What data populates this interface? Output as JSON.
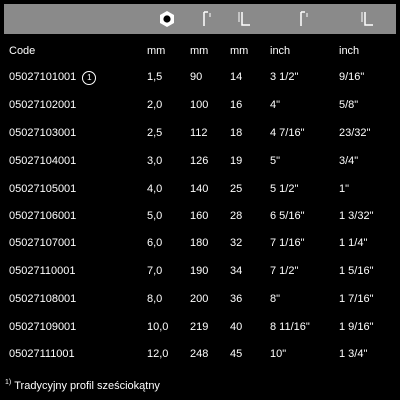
{
  "header_icons": [
    {
      "name": "hexagon-socket-icon"
    },
    {
      "name": "bracket-dimension-icon"
    },
    {
      "name": "l-dimension-icon"
    },
    {
      "name": "bracket-dimension-inch-icon"
    },
    {
      "name": "l-dimension-inch-icon"
    }
  ],
  "columns": [
    "Code",
    "mm",
    "mm",
    "mm",
    "inch",
    "inch"
  ],
  "rows": [
    {
      "code": "05027101001",
      "note": "1",
      "c1": "1,5",
      "c2": "90",
      "c3": "14",
      "c4": "3 1/2\"",
      "c5": "9/16\""
    },
    {
      "code": "05027102001",
      "c1": "2,0",
      "c2": "100",
      "c3": "16",
      "c4": "4\"",
      "c5": "5/8\""
    },
    {
      "code": "05027103001",
      "c1": "2,5",
      "c2": "112",
      "c3": "18",
      "c4": "4 7/16\"",
      "c5": "23/32\""
    },
    {
      "code": "05027104001",
      "c1": "3,0",
      "c2": "126",
      "c3": "19",
      "c4": "5\"",
      "c5": "3/4\""
    },
    {
      "code": "05027105001",
      "c1": "4,0",
      "c2": "140",
      "c3": "25",
      "c4": "5 1/2\"",
      "c5": "1\""
    },
    {
      "code": "05027106001",
      "c1": "5,0",
      "c2": "160",
      "c3": "28",
      "c4": "6 5/16\"",
      "c5": "1 3/32\""
    },
    {
      "code": "05027107001",
      "c1": "6,0",
      "c2": "180",
      "c3": "32",
      "c4": "7 1/16\"",
      "c5": "1 1/4\""
    },
    {
      "code": "05027110001",
      "c1": "7,0",
      "c2": "190",
      "c3": "34",
      "c4": "7 1/2\"",
      "c5": "1 5/16\""
    },
    {
      "code": "05027108001",
      "c1": "8,0",
      "c2": "200",
      "c3": "36",
      "c4": "8\"",
      "c5": "1 7/16\""
    },
    {
      "code": "05027109001",
      "c1": "10,0",
      "c2": "219",
      "c3": "40",
      "c4": "8 11/16\"",
      "c5": "1 9/16\""
    },
    {
      "code": "05027111001",
      "c1": "12,0",
      "c2": "248",
      "c3": "45",
      "c4": "10\"",
      "c5": "1 3/4\""
    }
  ],
  "footnote": {
    "marker": "1)",
    "text": "Tradycyjny profil sześciokątny"
  }
}
